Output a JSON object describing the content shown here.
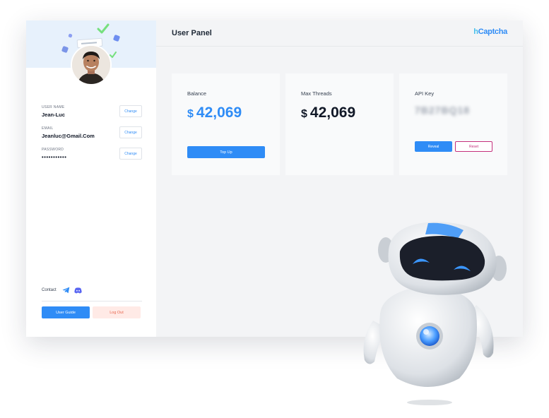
{
  "header": {
    "title": "User Panel",
    "brand": {
      "prefix": "h",
      "accent": "Captcha"
    }
  },
  "profile": {
    "fields": [
      {
        "label": "USER NAME",
        "value": "Jean-Luc",
        "action": "Change"
      },
      {
        "label": "EMAIL",
        "value": "Jeanluc@Gmail.Com",
        "action": "Change"
      },
      {
        "label": "PASSWORD",
        "value": "•••••••••••",
        "action": "Change"
      }
    ],
    "contact_label": "Contact",
    "guide_button": "User Guide",
    "logout_button": "Log Out"
  },
  "cards": {
    "balance": {
      "title": "Balance",
      "currency": "$",
      "amount": "42,069",
      "button": "Top Up"
    },
    "threads": {
      "title": "Max Threads",
      "currency": "$",
      "amount": "42,069"
    },
    "api": {
      "title": "API Key",
      "key": "7B27BQ18",
      "reveal": "Reveal",
      "reset": "Reset"
    }
  },
  "icons": [
    "telegram-icon",
    "discord-icon"
  ],
  "colors": {
    "primary": "#2f8cf6",
    "brand_h": "#46c0ec",
    "brand_captcha": "#2f8cf6",
    "reset": "#c4307c",
    "logout_bg": "#ffeae6",
    "logout_text": "#e8664e",
    "check": "#76e07e"
  }
}
